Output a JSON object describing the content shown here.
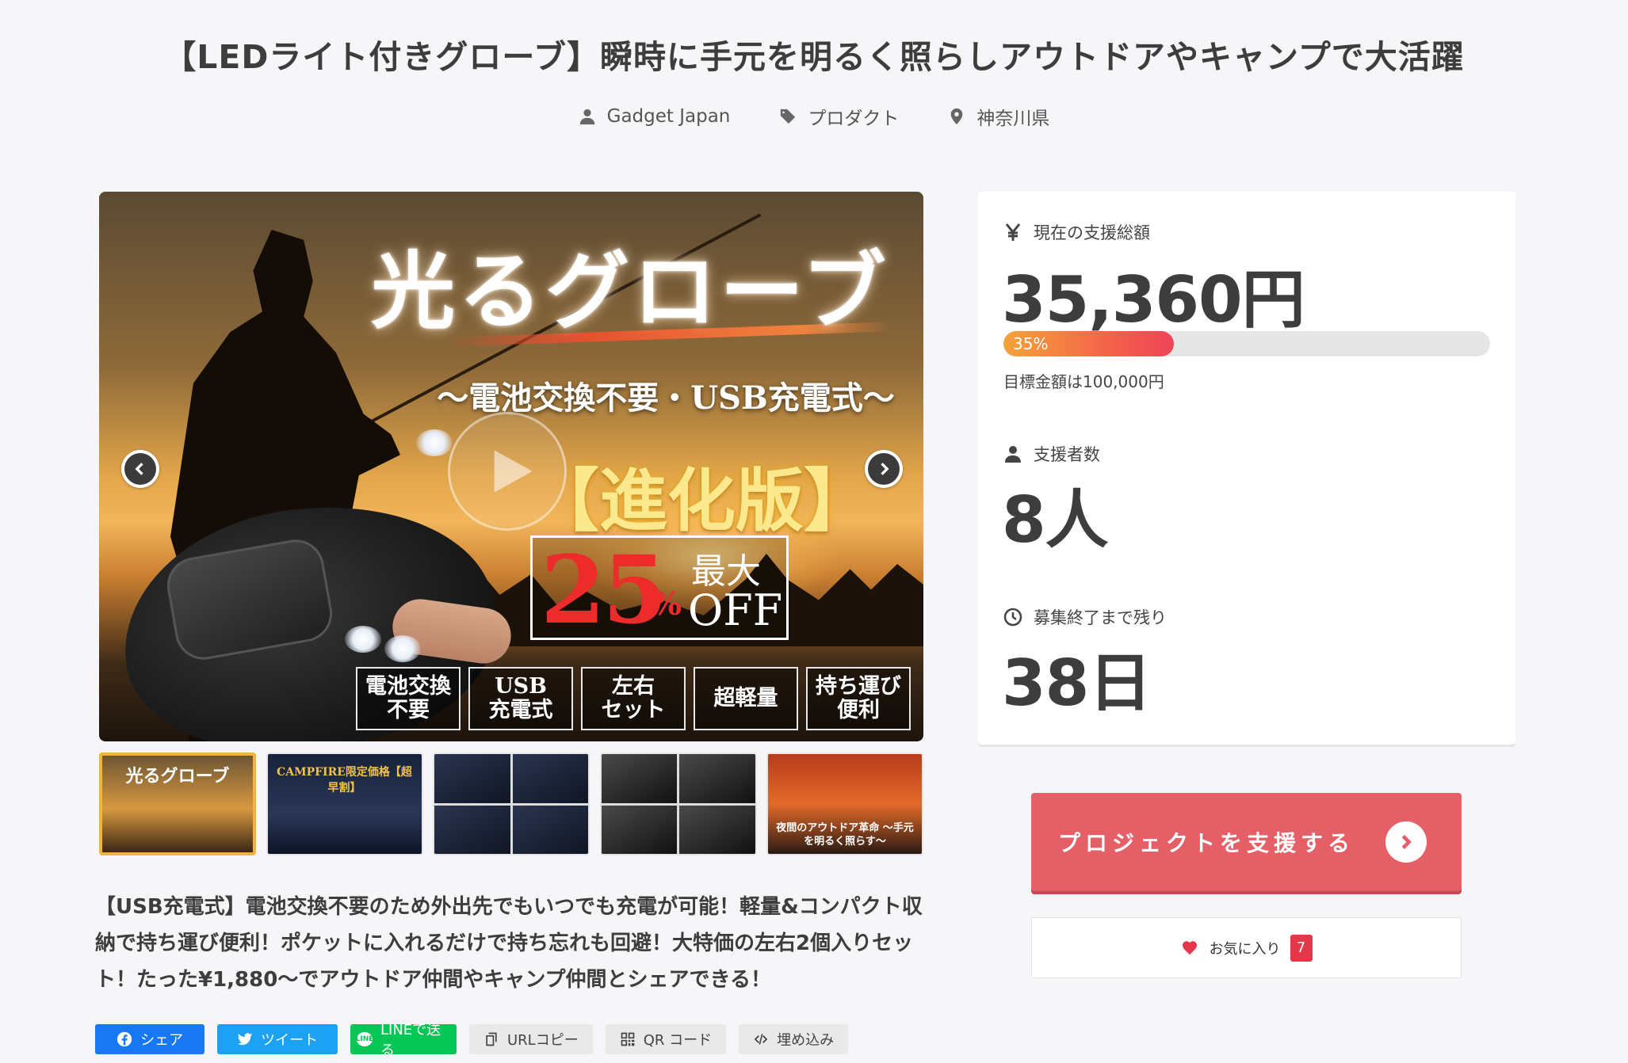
{
  "header": {
    "title": "【LEDライト付きグローブ】瞬時に手元を明るく照らしアウトドアやキャンプで大活躍",
    "owner": "Gadget Japan",
    "category": "プロダクト",
    "location": "神奈川県"
  },
  "hero": {
    "title": "光るグローブ",
    "subtitle": "〜電池交換不要・USB充電式〜",
    "edition": "【進化版】",
    "discount_number": "25",
    "discount_percent": "%",
    "discount_max": "最大",
    "discount_off": "OFF",
    "features": [
      "電池交換\n不要",
      "USB\n充電式",
      "左右\nセット",
      "超軽量",
      "持ち運び\n便利"
    ]
  },
  "thumbnails": [
    {
      "caption": "光るグローブ",
      "active": true
    },
    {
      "caption": "CAMPFIRE限定価格【超早割】",
      "active": false
    },
    {
      "caption": "",
      "active": false
    },
    {
      "caption": "",
      "active": false
    },
    {
      "caption": "夜間のアウトドア革命 〜手元を明るく照らす〜",
      "active": false
    }
  ],
  "description": "【USB充電式】電池交換不要のため外出先でもいつでも充電が可能！軽量&コンパクト収納で持ち運び便利！ポケットに入れるだけで持ち忘れも回避！大特価の左右2個入りセット！たった¥1,880〜でアウトドア仲間やキャンプ仲間とシェアできる！",
  "share": {
    "facebook": "シェア",
    "twitter": "ツイート",
    "line": "LINEで送る",
    "line_badge": "LINE",
    "url_copy": "URLコピー",
    "qr": "QR コード",
    "embed": "埋め込み"
  },
  "stats": {
    "total_label": "現在の支援総額",
    "total_value": "35,360円",
    "progress_percent": 35,
    "progress_text": "35%",
    "goal_text": "目標金額は100,000円",
    "supporters_label": "支援者数",
    "supporters_value": "8人",
    "remaining_label": "募集終了まで残り",
    "remaining_value": "38日"
  },
  "actions": {
    "support_label": "プロジェクトを支援する",
    "favorite_label": "お気に入り",
    "favorite_count": "7"
  },
  "colors": {
    "accent": "#e45f66",
    "progress_start": "#f5a33b",
    "progress_end": "#ef4558",
    "favorite": "#e5374a",
    "facebook": "#1877f2",
    "twitter": "#1da1f2",
    "line": "#06c755"
  }
}
